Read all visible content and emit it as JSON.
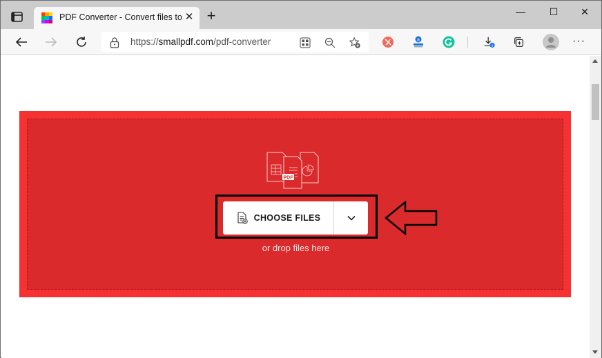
{
  "browser": {
    "tab": {
      "title": "PDF Converter - Convert files to a",
      "favicon_colors": [
        "#ff3d00",
        "#ffa000",
        "#ffd600",
        "#00c853",
        "#00b8d4",
        "#2962ff",
        "#7c4dff",
        "#d500f9",
        "#c51162"
      ],
      "close_icon": "close-icon"
    },
    "new_tab_label": "+",
    "window_controls": {
      "minimize": "—",
      "maximize": "☐",
      "close": "✕"
    },
    "address_bar": {
      "scheme": "https://",
      "host": "smallpdf.com",
      "path": "/pdf-converter"
    },
    "toolbar_icons": [
      "back-icon",
      "forward-icon",
      "refresh-icon",
      "lock-icon",
      "app-grid-icon",
      "zoom-out-icon",
      "add-favorite-icon",
      "extension-red-icon",
      "extension-stamp-icon",
      "grammarly-icon",
      "downloads-icon",
      "collections-icon",
      "profile-icon",
      "more-icon"
    ]
  },
  "page": {
    "choose_files_label": "CHOOSE FILES",
    "drop_hint": "or drop files here",
    "illustration_badge": "PDF",
    "colors": {
      "dropzone_outer": "#f53132",
      "dropzone_inner": "#db2a2c"
    }
  }
}
